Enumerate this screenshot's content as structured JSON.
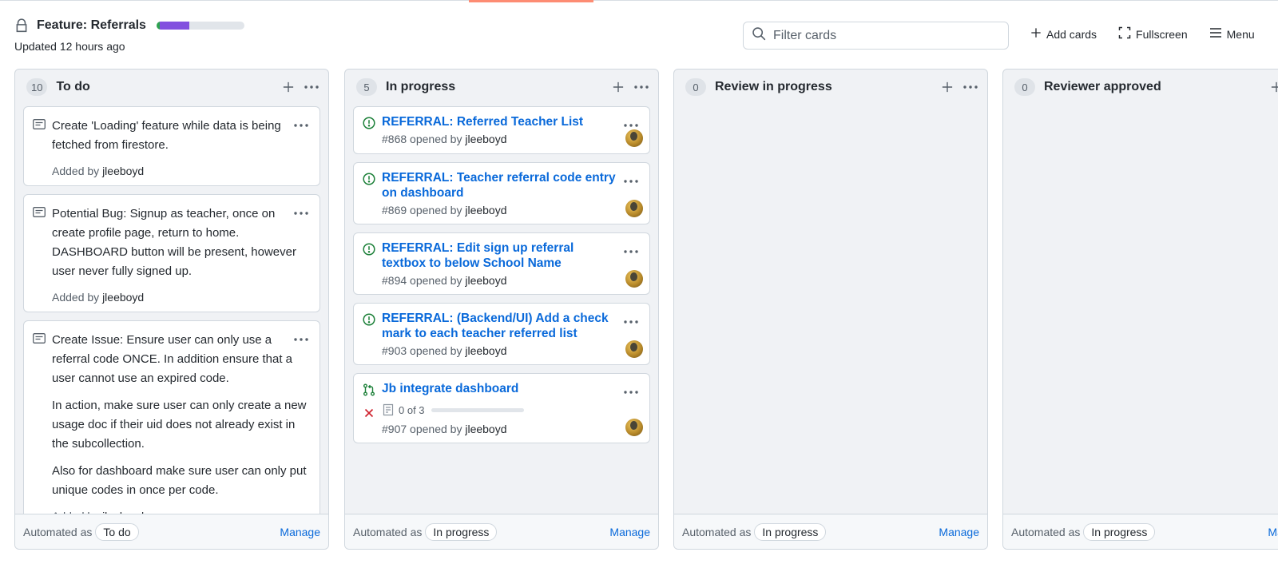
{
  "project": {
    "title": "Feature: Referrals",
    "updated": "Updated 12 hours ago",
    "progress": {
      "done_percent": 4,
      "in_progress_percent": 33,
      "done_color": "#2da44e",
      "in_progress_color": "#8250df"
    }
  },
  "toolbar": {
    "filter_placeholder": "Filter cards",
    "add_cards": "Add cards",
    "fullscreen": "Fullscreen",
    "menu": "Menu"
  },
  "colors": {
    "link": "#0969da",
    "open_issue": "#1a7f37",
    "closed_pr": "#cf222e",
    "accent": "#fd8c73"
  },
  "columns": [
    {
      "count": "10",
      "name": "To do",
      "automated_label": "Automated as",
      "automated_value": "To do",
      "manage": "Manage",
      "notes": [
        {
          "paragraphs": [
            "Create 'Loading' feature while data is being fetched from firestore."
          ],
          "added_prefix": "Added by",
          "author": "jleeboyd"
        },
        {
          "paragraphs": [
            "Potential Bug: Signup as teacher, once on create profile page, return to home. DASHBOARD button will be present, however user never fully signed up."
          ],
          "added_prefix": "Added by",
          "author": "jleeboyd"
        },
        {
          "paragraphs": [
            "Create Issue: Ensure user can only use a referral code ONCE. In addition ensure that a user cannot use an expired code.",
            "In action, make sure user can only create a new usage doc if their uid does not already exist in the subcollection.",
            "Also for dashboard make sure user can only put unique codes in once per code."
          ],
          "added_prefix": "Added by",
          "author": "jleeboyd"
        }
      ]
    },
    {
      "count": "5",
      "name": "In progress",
      "automated_label": "Automated as",
      "automated_value": "In progress",
      "manage": "Manage",
      "issues": [
        {
          "title": "REFERRAL: Referred Teacher List",
          "number": "#868",
          "opened_by": "opened by",
          "author": "jleeboyd"
        },
        {
          "title": "REFERRAL: Teacher referral code entry on dashboard",
          "number": "#869",
          "opened_by": "opened by",
          "author": "jleeboyd"
        },
        {
          "title": "REFERRAL: Edit sign up referral textbox to below School Name",
          "number": "#894",
          "opened_by": "opened by",
          "author": "jleeboyd"
        },
        {
          "title": "REFERRAL: (Backend/UI) Add a check mark to each teacher referred list",
          "number": "#903",
          "opened_by": "opened by",
          "author": "jleeboyd"
        }
      ],
      "pr": {
        "title": "Jb integrate dashboard",
        "checklist": "0 of 3",
        "number": "#907",
        "opened_by": "opened by",
        "author": "jleeboyd"
      }
    },
    {
      "count": "0",
      "name": "Review in progress",
      "automated_label": "Automated as",
      "automated_value": "In progress",
      "manage": "Manage"
    },
    {
      "count": "0",
      "name": "Reviewer approved",
      "automated_label": "Automated as",
      "automated_value": "In progress",
      "manage": "Manage"
    }
  ]
}
